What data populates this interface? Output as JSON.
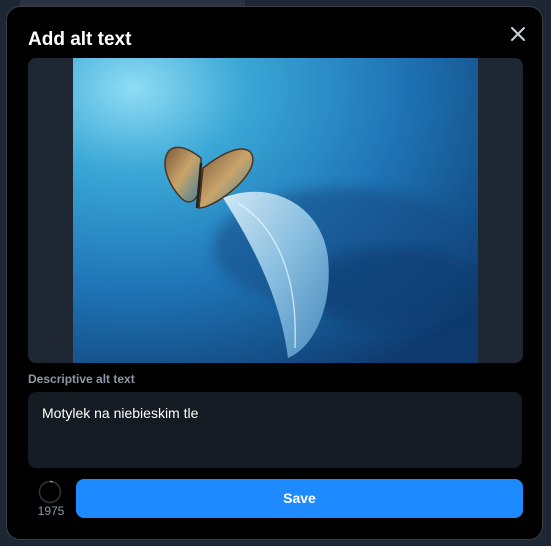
{
  "dialog": {
    "title": "Add alt text",
    "close_icon": "close-icon"
  },
  "preview": {
    "image_description": ""
  },
  "alt_text": {
    "label": "Descriptive alt text",
    "value": "Motylek na niebieskim tle"
  },
  "footer": {
    "remaining_characters": "1975",
    "save_label": "Save"
  },
  "colors": {
    "accent": "#1d8aff",
    "dialog_background": "#000000",
    "input_background": "#151b22",
    "muted_text": "#8b98a5"
  }
}
